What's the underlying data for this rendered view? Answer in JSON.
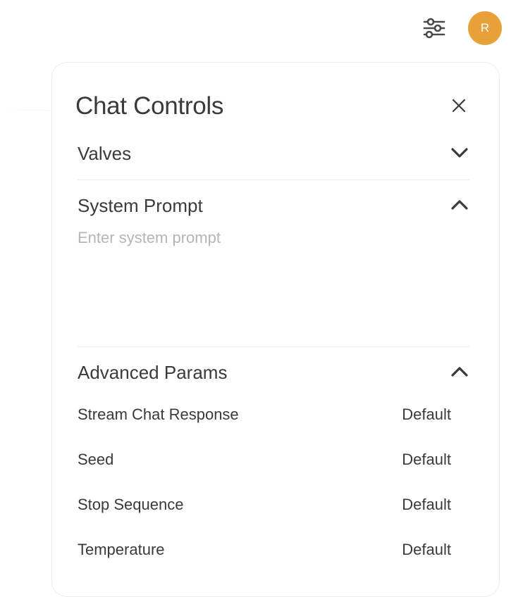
{
  "header": {
    "controls_icon": "sliders-icon",
    "avatar_initial": "R",
    "avatar_color": "#e8a03b"
  },
  "panel": {
    "title": "Chat Controls",
    "close_icon": "close-icon",
    "sections": {
      "valves": {
        "label": "Valves",
        "state": "collapsed"
      },
      "system_prompt": {
        "label": "System Prompt",
        "state": "expanded",
        "value": "",
        "placeholder": "Enter system prompt"
      },
      "advanced_params": {
        "label": "Advanced Params",
        "state": "expanded",
        "params": [
          {
            "label": "Stream Chat Response",
            "value": "Default"
          },
          {
            "label": "Seed",
            "value": "Default"
          },
          {
            "label": "Stop Sequence",
            "value": "Default"
          },
          {
            "label": "Temperature",
            "value": "Default"
          }
        ]
      }
    }
  }
}
